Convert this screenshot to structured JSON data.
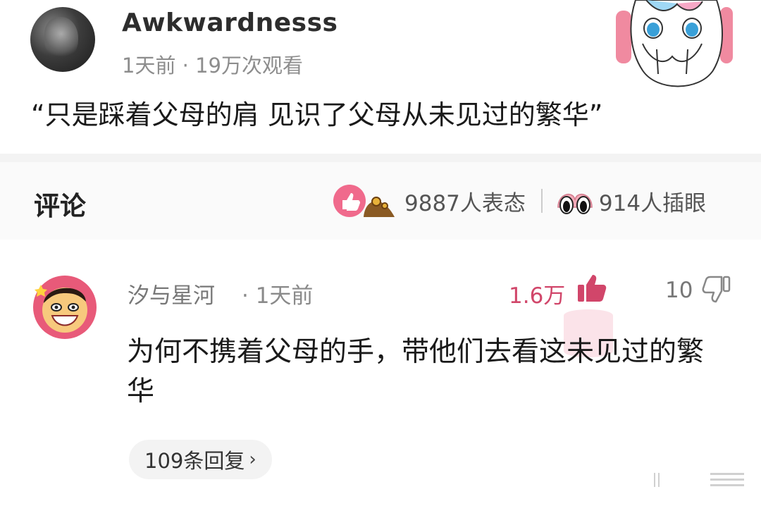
{
  "post": {
    "username": "Awkwardnesss",
    "meta": "1天前 · 19万次观看",
    "text": "“只是踩着父母的肩 见识了父母从未见过的繁华”"
  },
  "comments_header": {
    "title": "评论",
    "reactions_label": "9887人表态",
    "eyes_label": "914人插眼"
  },
  "comment": {
    "user": "汐与星河",
    "time": "· 1天前",
    "likes": "1.6万",
    "dislikes": "10",
    "text": "为何不携着父母的手，带他们去看这未见过的繁华",
    "replies_label": "109条回复",
    "replies_chevron": "›"
  },
  "icons": {
    "like": "thumbs-up-icon",
    "dislike": "thumbs-down-icon",
    "eyes": "eyes-icon",
    "reaction": "like-badge-icon"
  },
  "colors": {
    "accent": "#d1466a",
    "muted": "#8d8d8d"
  }
}
